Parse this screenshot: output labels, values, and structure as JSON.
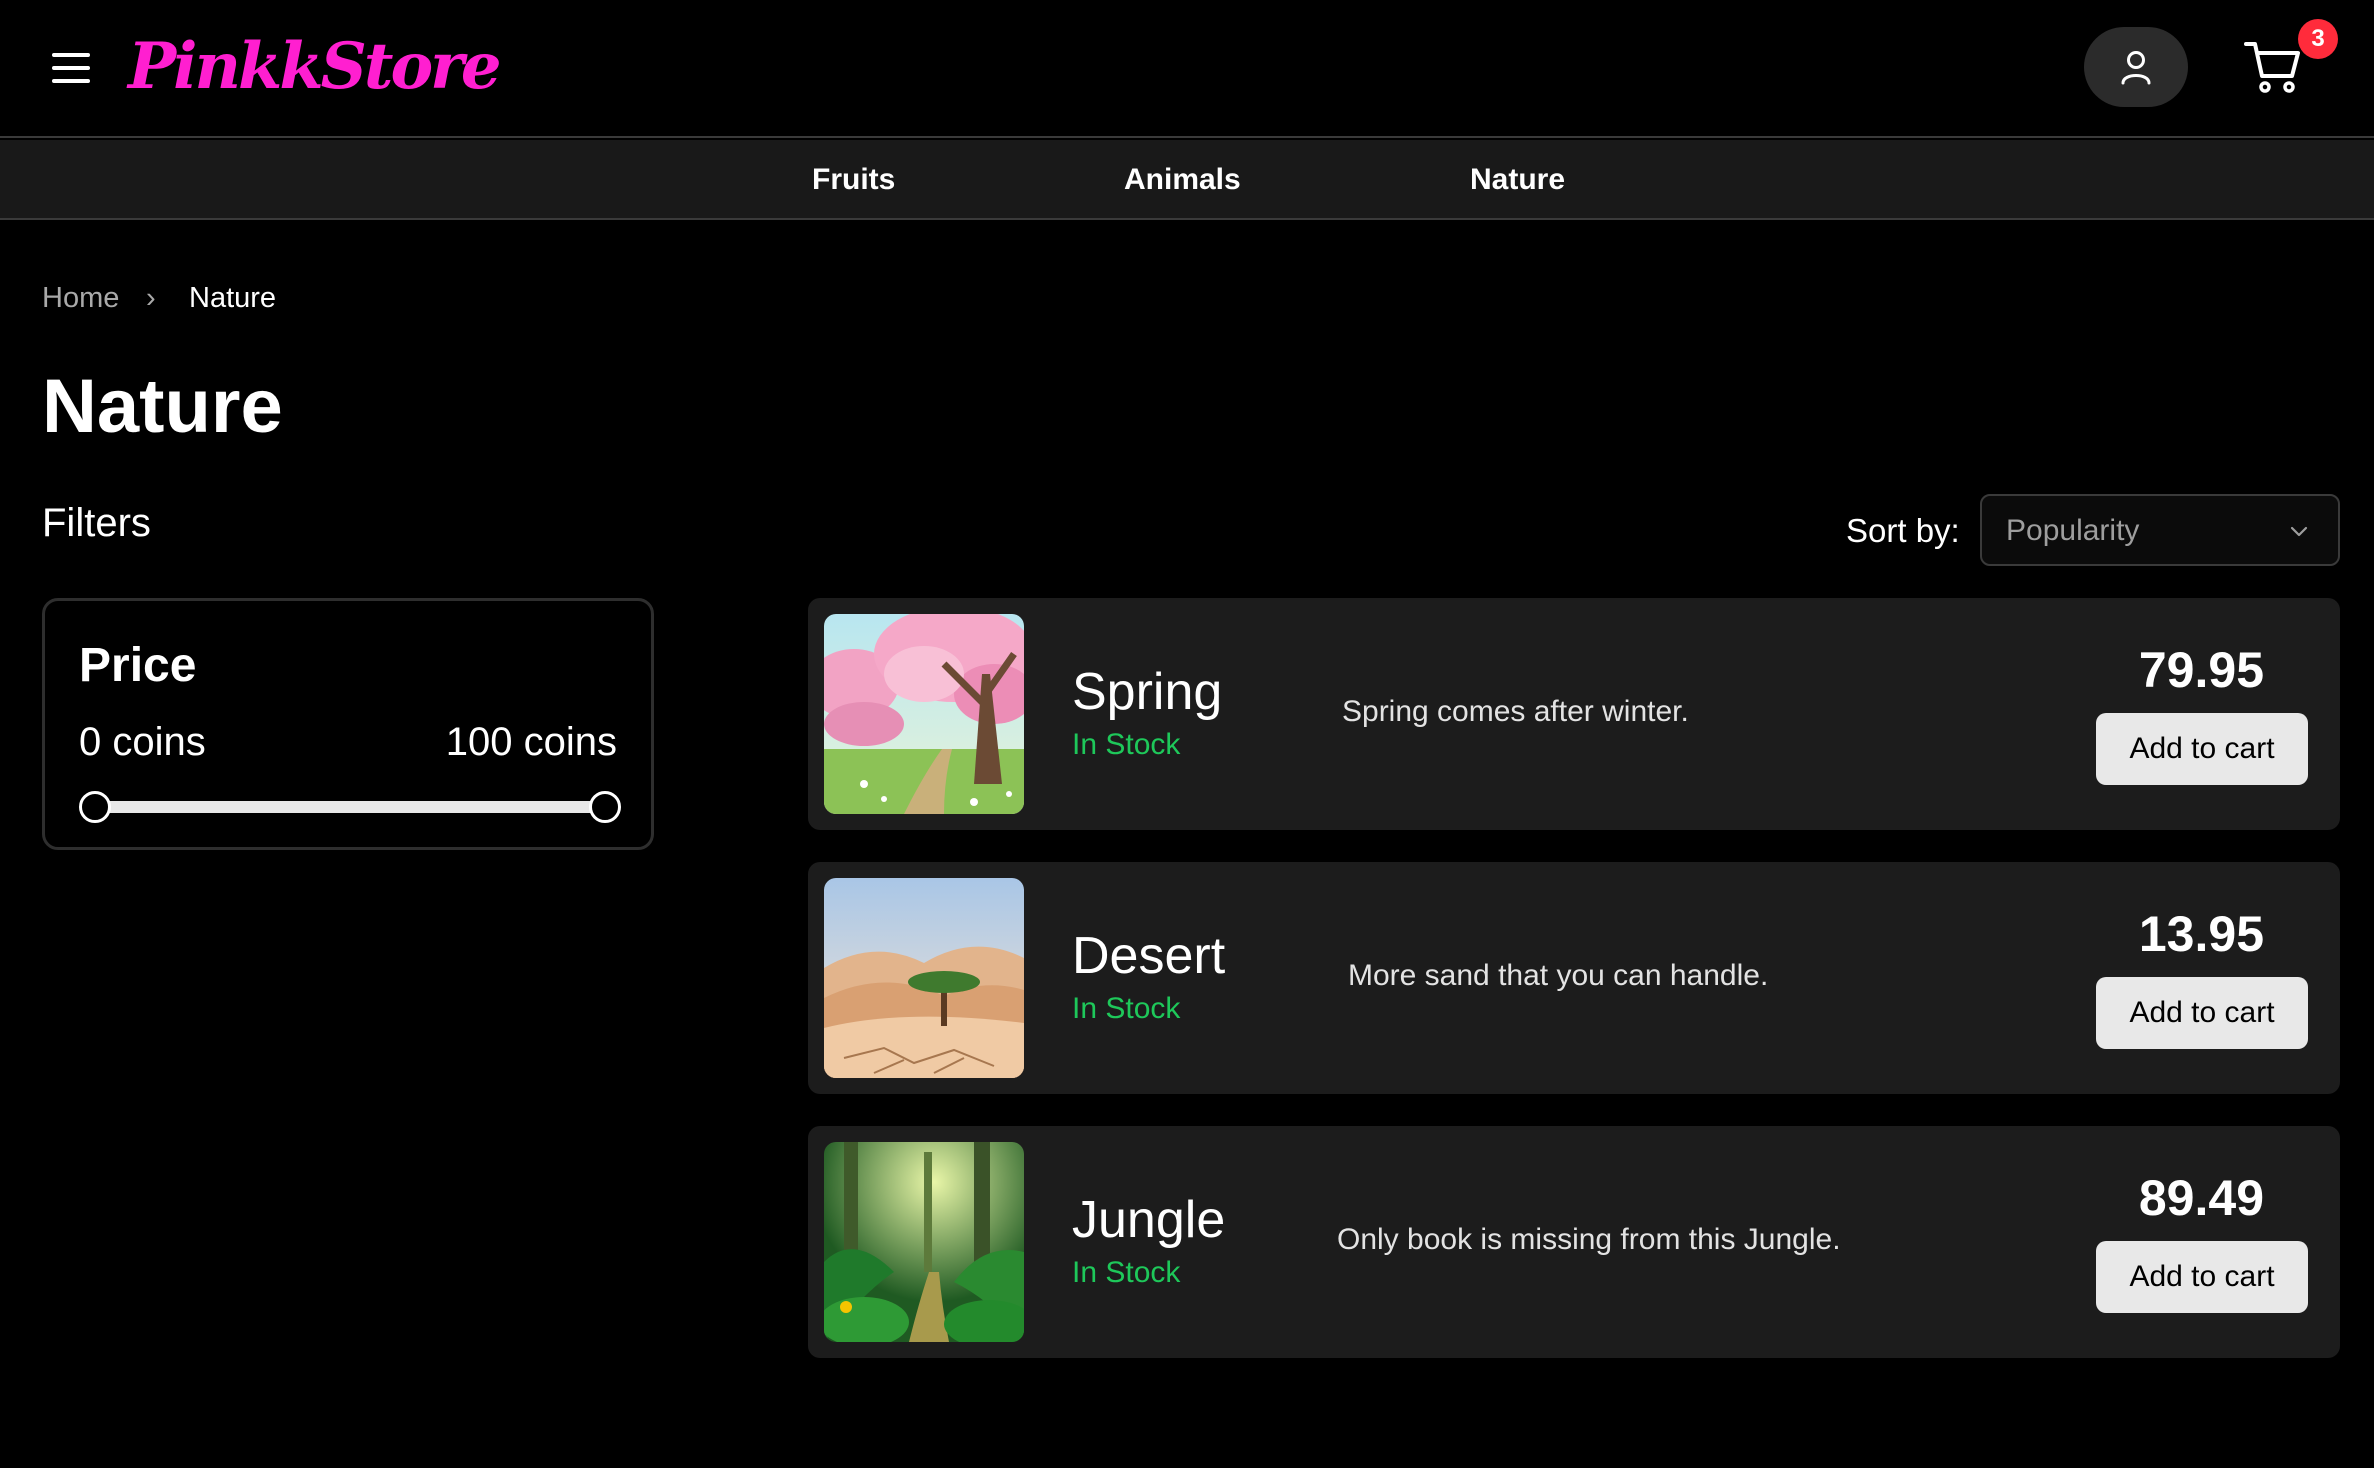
{
  "header": {
    "logo": "PinkkStore",
    "logo_color": "#ff1fd0",
    "menu_icon": "hamburger-menu-icon",
    "user_icon": "user-icon",
    "cart_icon": "shopping-cart-icon",
    "cart_count": "3",
    "badge_color": "#ff2b3b"
  },
  "nav": {
    "items": [
      {
        "label": "Fruits"
      },
      {
        "label": "Animals"
      },
      {
        "label": "Nature"
      }
    ]
  },
  "breadcrumb": {
    "home": "Home",
    "separator": "›",
    "current": "Nature"
  },
  "page": {
    "title": "Nature"
  },
  "filters": {
    "title": "Filters",
    "price": {
      "title": "Price",
      "min_label": "0 coins",
      "max_label": "100 coins",
      "range_fraction": [
        0,
        1
      ]
    }
  },
  "sort": {
    "label": "Sort by:",
    "selected": "Popularity"
  },
  "products": [
    {
      "name": "Spring",
      "stock": "In Stock",
      "description": "Spring comes after winter.",
      "price": "79.95",
      "button_label": "Add to cart",
      "image": "spring-blossom-tree-image"
    },
    {
      "name": "Desert",
      "stock": "In Stock",
      "description": "More sand that you can handle.",
      "price": "13.95",
      "button_label": "Add to cart",
      "image": "desert-dunes-tree-image"
    },
    {
      "name": "Jungle",
      "stock": "In Stock",
      "description": "Only book is missing from this Jungle.",
      "price": "89.49",
      "button_label": "Add to cart",
      "image": "jungle-forest-path-image"
    }
  ],
  "colors": {
    "stock_green": "#1ec85a",
    "card_bg": "#1c1c1c",
    "nav_bg": "#191919"
  }
}
